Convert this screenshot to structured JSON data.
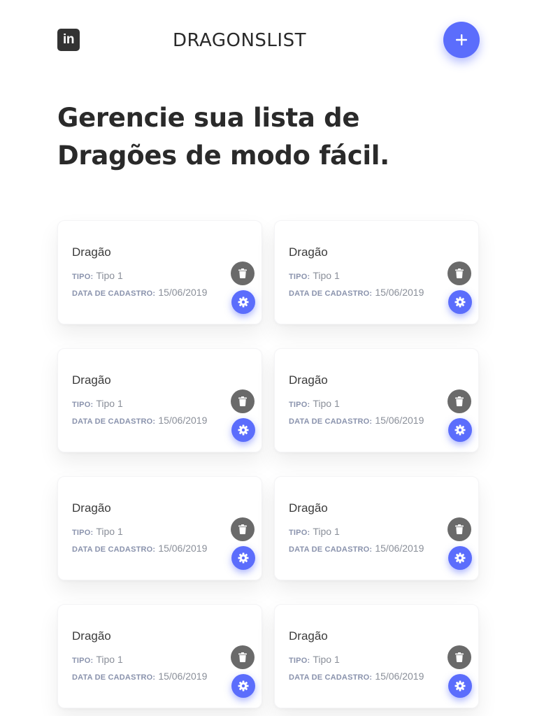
{
  "header": {
    "logo_text": "in",
    "brand": "DRAGONSLIST",
    "add_button_icon": "plus-icon"
  },
  "hero": {
    "title": "Gerencie sua lista de Dragões de modo fácil."
  },
  "colors": {
    "accent": "#5b6dfc",
    "delete_button": "#6a6a6a",
    "text_dark": "#2a2a2a",
    "label": "#8a93ad"
  },
  "cards": [
    {
      "name": "Dragão",
      "type_label": "TIPO:",
      "type_value": "Tipo 1",
      "date_label": "DATA DE CADASTRO:",
      "date_value": "15/06/2019"
    },
    {
      "name": "Dragão",
      "type_label": "TIPO:",
      "type_value": "Tipo 1",
      "date_label": "DATA DE CADASTRO:",
      "date_value": "15/06/2019"
    },
    {
      "name": "Dragão",
      "type_label": "TIPO:",
      "type_value": "Tipo 1",
      "date_label": "DATA DE CADASTRO:",
      "date_value": "15/06/2019"
    },
    {
      "name": "Dragão",
      "type_label": "TIPO:",
      "type_value": "Tipo 1",
      "date_label": "DATA DE CADASTRO:",
      "date_value": "15/06/2019"
    },
    {
      "name": "Dragão",
      "type_label": "TIPO:",
      "type_value": "Tipo 1",
      "date_label": "DATA DE CADASTRO:",
      "date_value": "15/06/2019"
    },
    {
      "name": "Dragão",
      "type_label": "TIPO:",
      "type_value": "Tipo 1",
      "date_label": "DATA DE CADASTRO:",
      "date_value": "15/06/2019"
    },
    {
      "name": "Dragão",
      "type_label": "TIPO:",
      "type_value": "Tipo 1",
      "date_label": "DATA DE CADASTRO:",
      "date_value": "15/06/2019"
    },
    {
      "name": "Dragão",
      "type_label": "TIPO:",
      "type_value": "Tipo 1",
      "date_label": "DATA DE CADASTRO:",
      "date_value": "15/06/2019"
    }
  ]
}
